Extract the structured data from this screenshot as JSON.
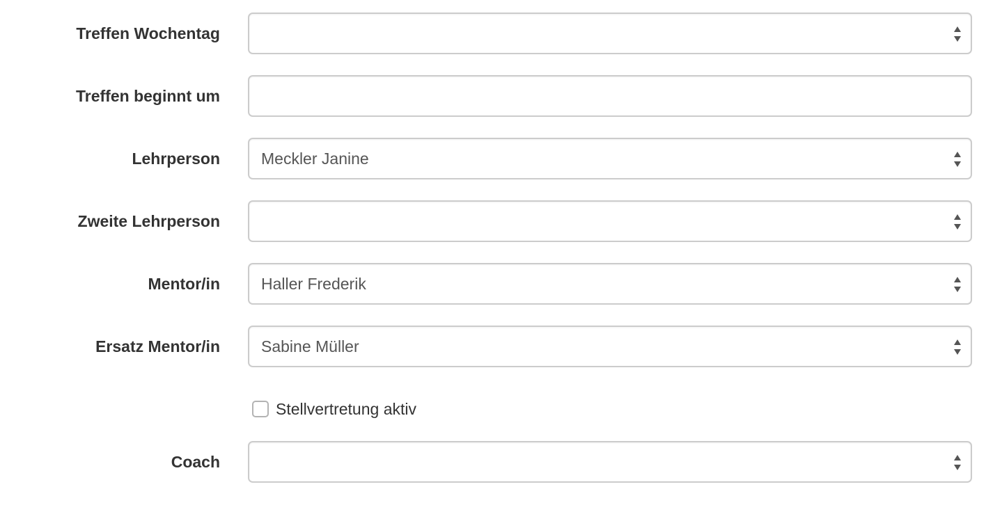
{
  "form": {
    "fields": [
      {
        "label": "Treffen Wochentag",
        "type": "select",
        "value": ""
      },
      {
        "label": "Treffen beginnt um",
        "type": "text",
        "value": ""
      },
      {
        "label": "Lehrperson",
        "type": "select",
        "value": "Meckler Janine"
      },
      {
        "label": "Zweite Lehrperson",
        "type": "select",
        "value": ""
      },
      {
        "label": "Mentor/in",
        "type": "select",
        "value": "Haller Frederik"
      },
      {
        "label": "Ersatz Mentor/in",
        "type": "select",
        "value": "Sabine Müller"
      }
    ],
    "checkbox": {
      "label": "Stellvertretung aktiv",
      "checked": false
    },
    "coach": {
      "label": "Coach",
      "type": "select",
      "value": ""
    }
  },
  "icons": {
    "select_arrows": "select-up-down-arrows-icon"
  },
  "colors": {
    "label_text": "#333333",
    "value_text": "#555555",
    "border": "#cccccc",
    "arrow": "#555555"
  }
}
